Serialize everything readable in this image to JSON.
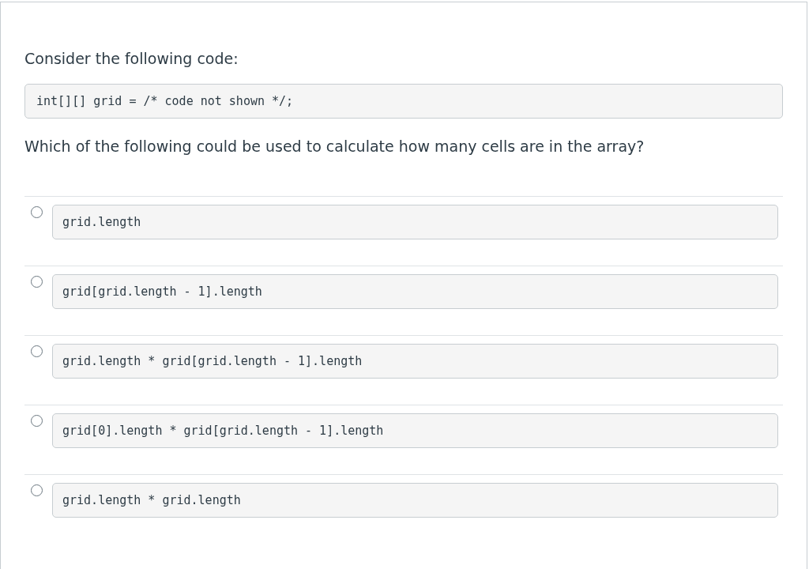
{
  "prompt": "Consider the following code:",
  "code": "int[][] grid = /* code not shown */;",
  "question": "Which of the following could be used to calculate how many cells are in the array?",
  "options": [
    {
      "code": "grid.length",
      "selected": false
    },
    {
      "code": "grid[grid.length - 1].length",
      "selected": false
    },
    {
      "code": "grid.length * grid[grid.length - 1].length",
      "selected": false
    },
    {
      "code": "grid[0].length * grid[grid.length - 1].length",
      "selected": false
    },
    {
      "code": "grid.length * grid.length",
      "selected": false
    }
  ]
}
